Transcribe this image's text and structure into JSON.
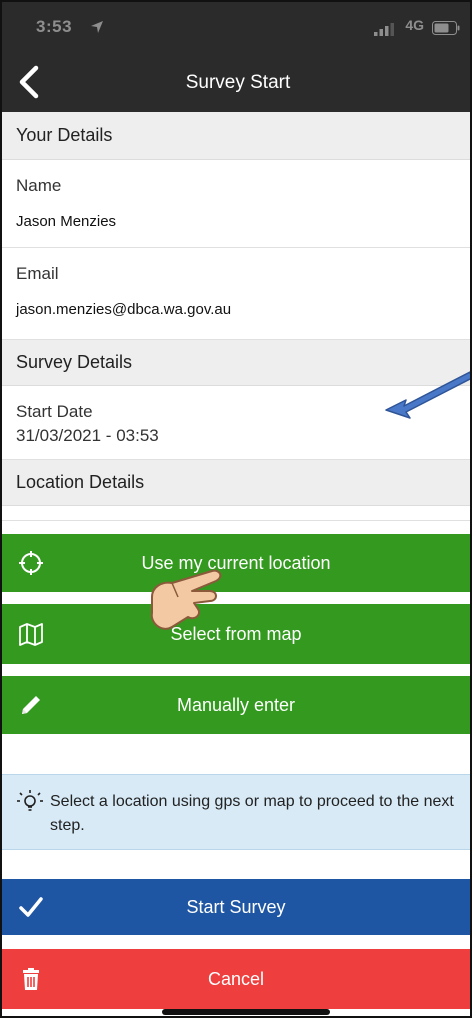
{
  "status_bar": {
    "time": "3:53",
    "network": "4G",
    "icons": [
      "location-arrow-icon",
      "signal-icon",
      "battery-icon"
    ]
  },
  "nav": {
    "title": "Survey Start",
    "back_icon": "chevron-left-icon"
  },
  "your_details": {
    "header": "Your Details",
    "name_label": "Name",
    "name_value": "Jason Menzies",
    "email_label": "Email",
    "email_value": "jason.menzies@dbca.wa.gov.au"
  },
  "survey_details": {
    "header": "Survey Details",
    "start_date_label": "Start Date",
    "start_date_value": "31/03/2021 - 03:53"
  },
  "location_details": {
    "header": "Location Details",
    "buttons": [
      {
        "label": "Use my current location",
        "icon": "crosshair-icon"
      },
      {
        "label": "Select from map",
        "icon": "map-icon"
      },
      {
        "label": "Manually enter",
        "icon": "pencil-icon"
      }
    ]
  },
  "hint": {
    "text": "Select a location using gps or map to proceed to the next step.",
    "icon": "lightbulb-icon"
  },
  "footer": {
    "start_label": "Start Survey",
    "start_icon": "check-icon",
    "cancel_label": "Cancel",
    "cancel_icon": "trash-icon"
  },
  "colors": {
    "header_bg": "#2b2b2b",
    "green": "#339a1f",
    "blue": "#1f56a3",
    "red": "#ee3e3e",
    "hint_bg": "#d7eaf6",
    "section_bg": "#eeeeee"
  }
}
